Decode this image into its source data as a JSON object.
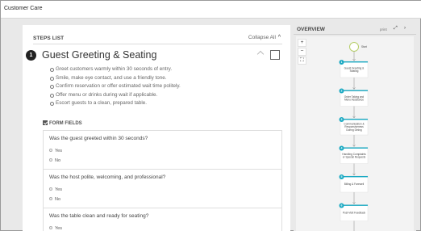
{
  "window": {
    "title": "Customer Care"
  },
  "steps": {
    "header": "STEPS LIST",
    "collapse_label": "Collapse All",
    "collapse_icon": "chevron-up-icon",
    "step": {
      "number": "1",
      "title": "Guest Greeting & Seating",
      "bullets": [
        "Greet customers warmly within 30 seconds of entry.",
        "Smile, make eye contact, and use a friendly tone.",
        "Confirm reservation or offer estimated wait time politely.",
        "Offer menu or drinks during wait if applicable.",
        "Escort guests to a clean, prepared table."
      ]
    },
    "form_fields_label": "FORM FIELDS",
    "questions": [
      {
        "text": "Was the guest greeted within 30 seconds?",
        "options": [
          "Yes",
          "No"
        ]
      },
      {
        "text": "Was the host polite, welcoming, and professional?",
        "options": [
          "Yes",
          "No"
        ]
      },
      {
        "text": "Was the table clean and ready for seating?",
        "options": [
          "Yes"
        ]
      }
    ]
  },
  "overview": {
    "title": "OVERVIEW",
    "print_label": "print",
    "expand_icon": "expand-icon",
    "chevron_icon": "chevron-right-icon",
    "zoom_in": "+",
    "zoom_out": "−",
    "fit": "⛶",
    "start_label": "Start",
    "nodes": [
      {
        "num": "1",
        "lines": [
          "Guest Greeting &",
          "Seating"
        ]
      },
      {
        "num": "2",
        "lines": [
          "Order Taking and",
          "Menu Assistance"
        ]
      },
      {
        "num": "3",
        "lines": [
          "Communication &",
          "Responsiveness",
          "During Dining"
        ]
      },
      {
        "num": "4",
        "lines": [
          "Handling Complaints",
          "or Special Requests"
        ]
      },
      {
        "num": "5",
        "lines": [
          "Billing & Farewell"
        ]
      },
      {
        "num": "6",
        "lines": [
          "Post-Visit Feedback"
        ]
      }
    ],
    "accent_color": "#1aa9c2"
  }
}
